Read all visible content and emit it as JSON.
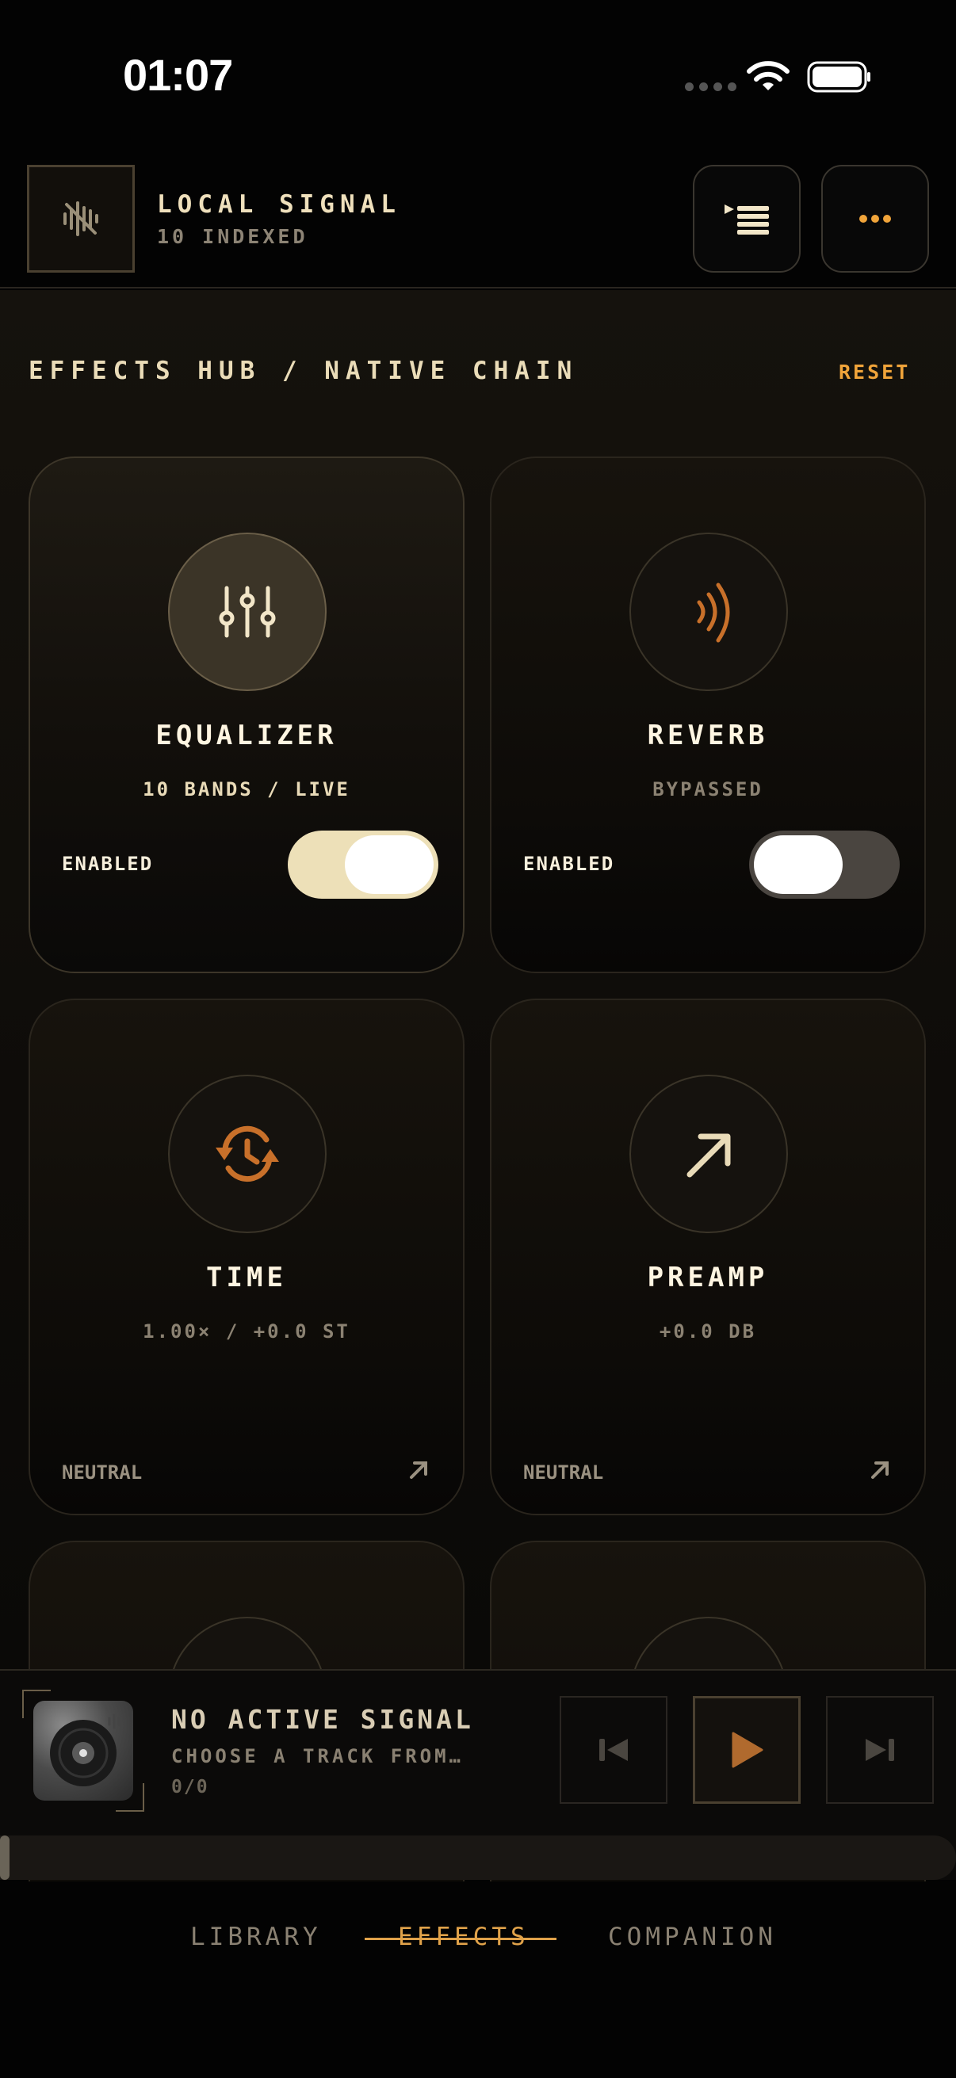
{
  "status": {
    "time": "01:07"
  },
  "header": {
    "brand_title": "LOCAL SIGNAL",
    "brand_sub": "10 INDEXED",
    "queue_icon": "queue-list-icon",
    "more_icon": "more-dots-icon"
  },
  "section": {
    "title": "EFFECTS HUB / NATIVE CHAIN",
    "reset_label": "RESET"
  },
  "cards": [
    {
      "title": "EQUALIZER",
      "subtitle": "10 BANDS / LIVE",
      "label": "ENABLED",
      "enabled": true,
      "icon": "sliders-icon"
    },
    {
      "title": "REVERB",
      "subtitle": "BYPASSED",
      "label": "ENABLED",
      "enabled": false,
      "icon": "waves-icon"
    },
    {
      "title": "TIME",
      "subtitle": "1.00× / +0.0 ST",
      "label": "NEUTRAL",
      "icon": "time-sync-icon"
    },
    {
      "title": "PREAMP",
      "subtitle": "+0.0 DB",
      "label": "NEUTRAL",
      "icon": "arrow-up-right-icon"
    }
  ],
  "player": {
    "title": "NO ACTIVE SIGNAL",
    "subtitle": "CHOOSE A TRACK FROM…",
    "count": "0/0",
    "progress": 0
  },
  "tabs": [
    {
      "label": "LIBRARY",
      "active": false
    },
    {
      "label": "EFFECTS",
      "active": true
    },
    {
      "label": "COMPANION",
      "active": false
    }
  ],
  "colors": {
    "accent": "#e0a24a",
    "reset": "#f0a43a",
    "icon_orange": "#c8702a",
    "toggle_on": "#ede0b8"
  }
}
